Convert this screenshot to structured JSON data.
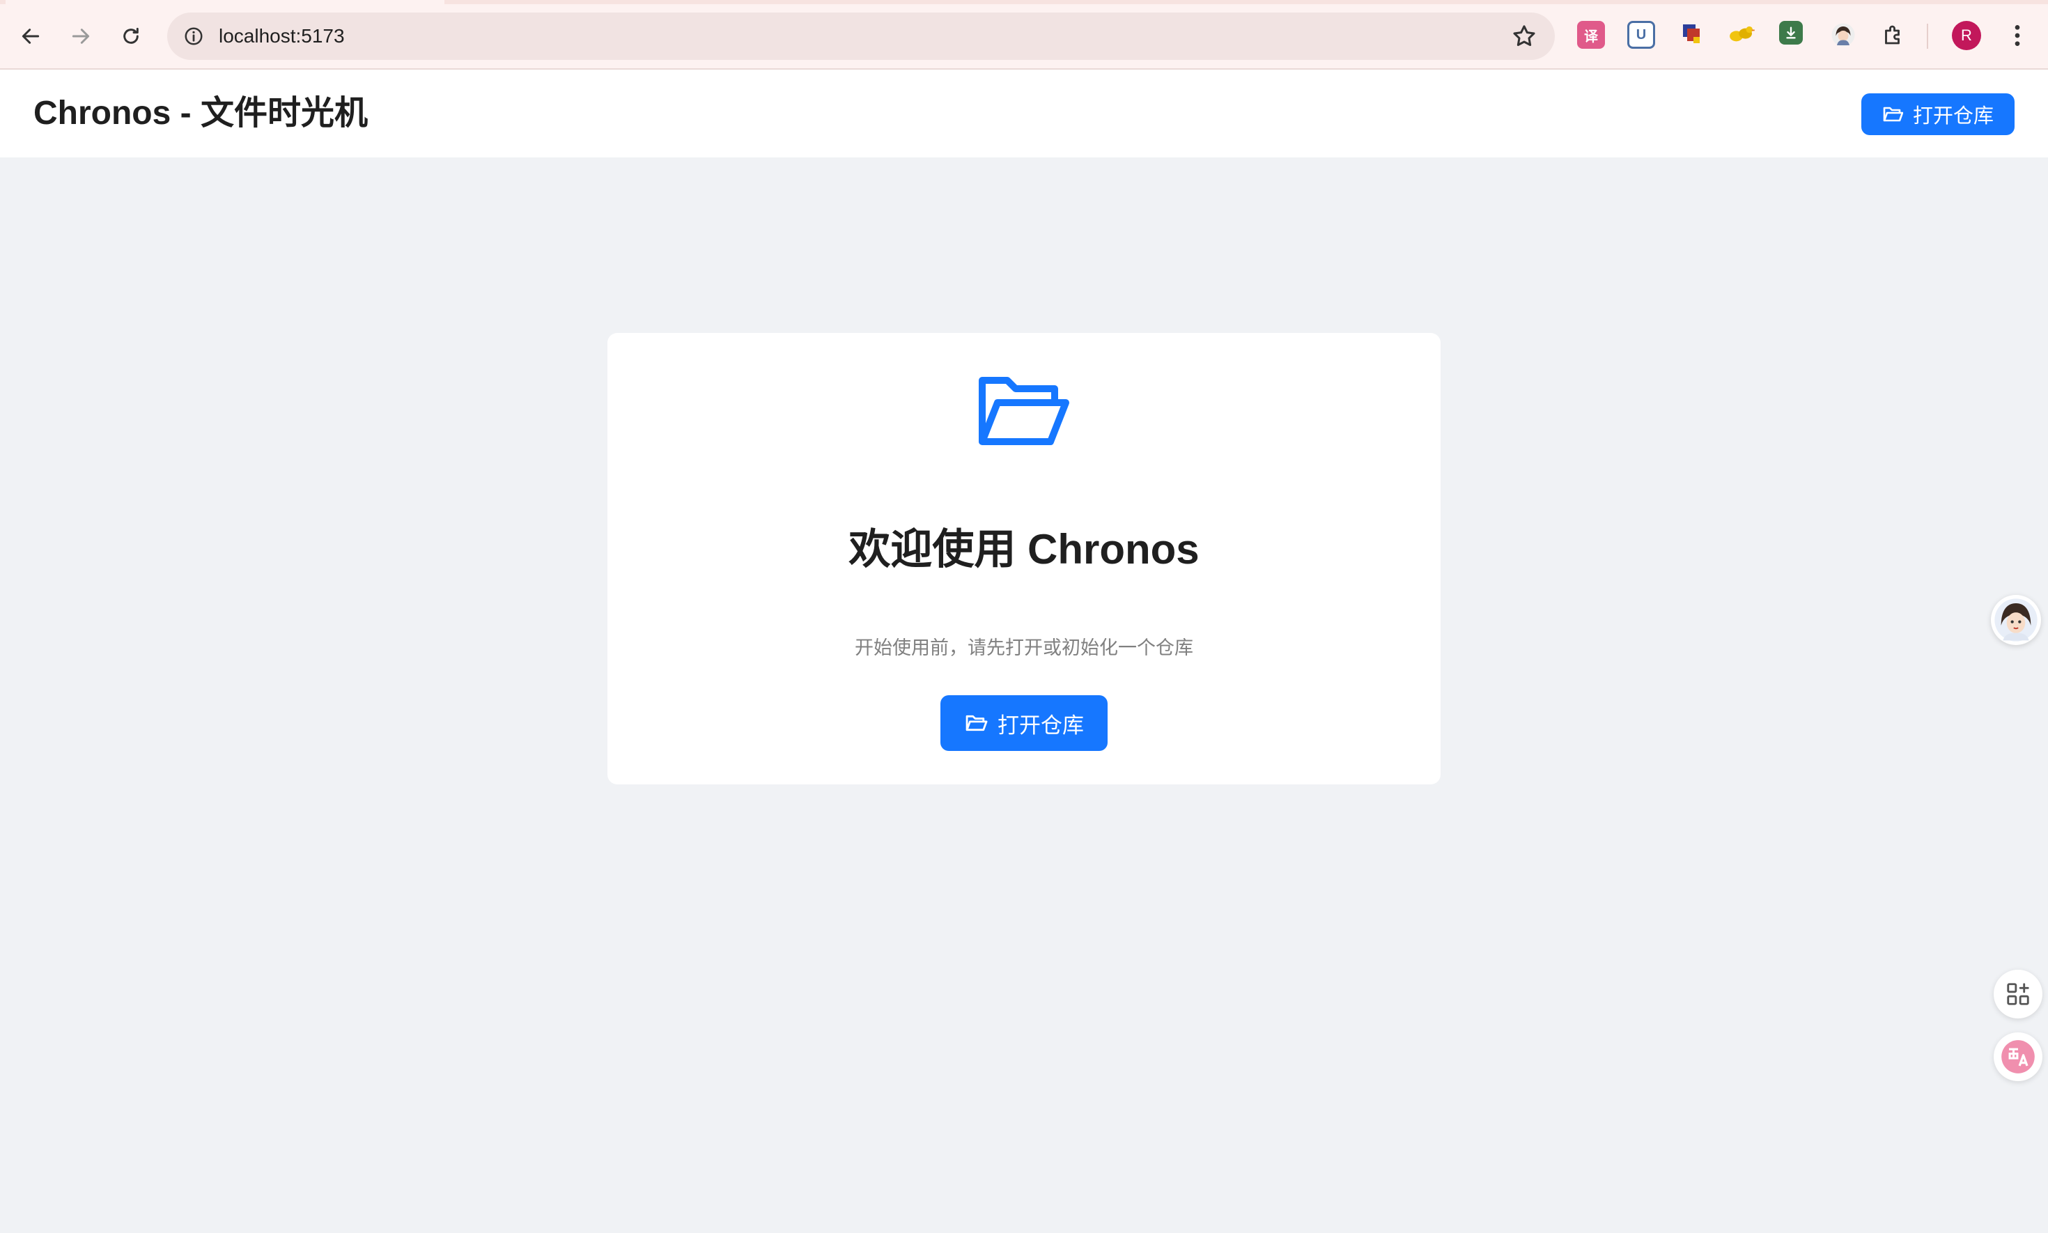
{
  "browser": {
    "url": "localhost:5173",
    "profile_initial": "R",
    "extensions": [
      {
        "name": "translate-extension",
        "label": "译",
        "color": "#e05a8a"
      },
      {
        "name": "u-extension",
        "label": "U",
        "color": "#4a6fa5"
      },
      {
        "name": "pixel-bird-extension",
        "label": "",
        "color": "#c0392b"
      },
      {
        "name": "ducks-extension",
        "label": "",
        "color": "#e0b000"
      },
      {
        "name": "download-extension",
        "label": "",
        "color": "#3d7a4a"
      },
      {
        "name": "avatar-extension",
        "label": "",
        "color": "#555555"
      }
    ]
  },
  "header": {
    "title": "Chronos - 文件时光机",
    "open_repo_label": "打开仓库"
  },
  "welcome": {
    "title": "欢迎使用 Chronos",
    "subtitle": "开始使用前，请先打开或初始化一个仓库",
    "open_repo_label": "打开仓库"
  },
  "colors": {
    "primary": "#1677ff",
    "page_background": "#f0f2f5",
    "card_background": "#ffffff"
  }
}
